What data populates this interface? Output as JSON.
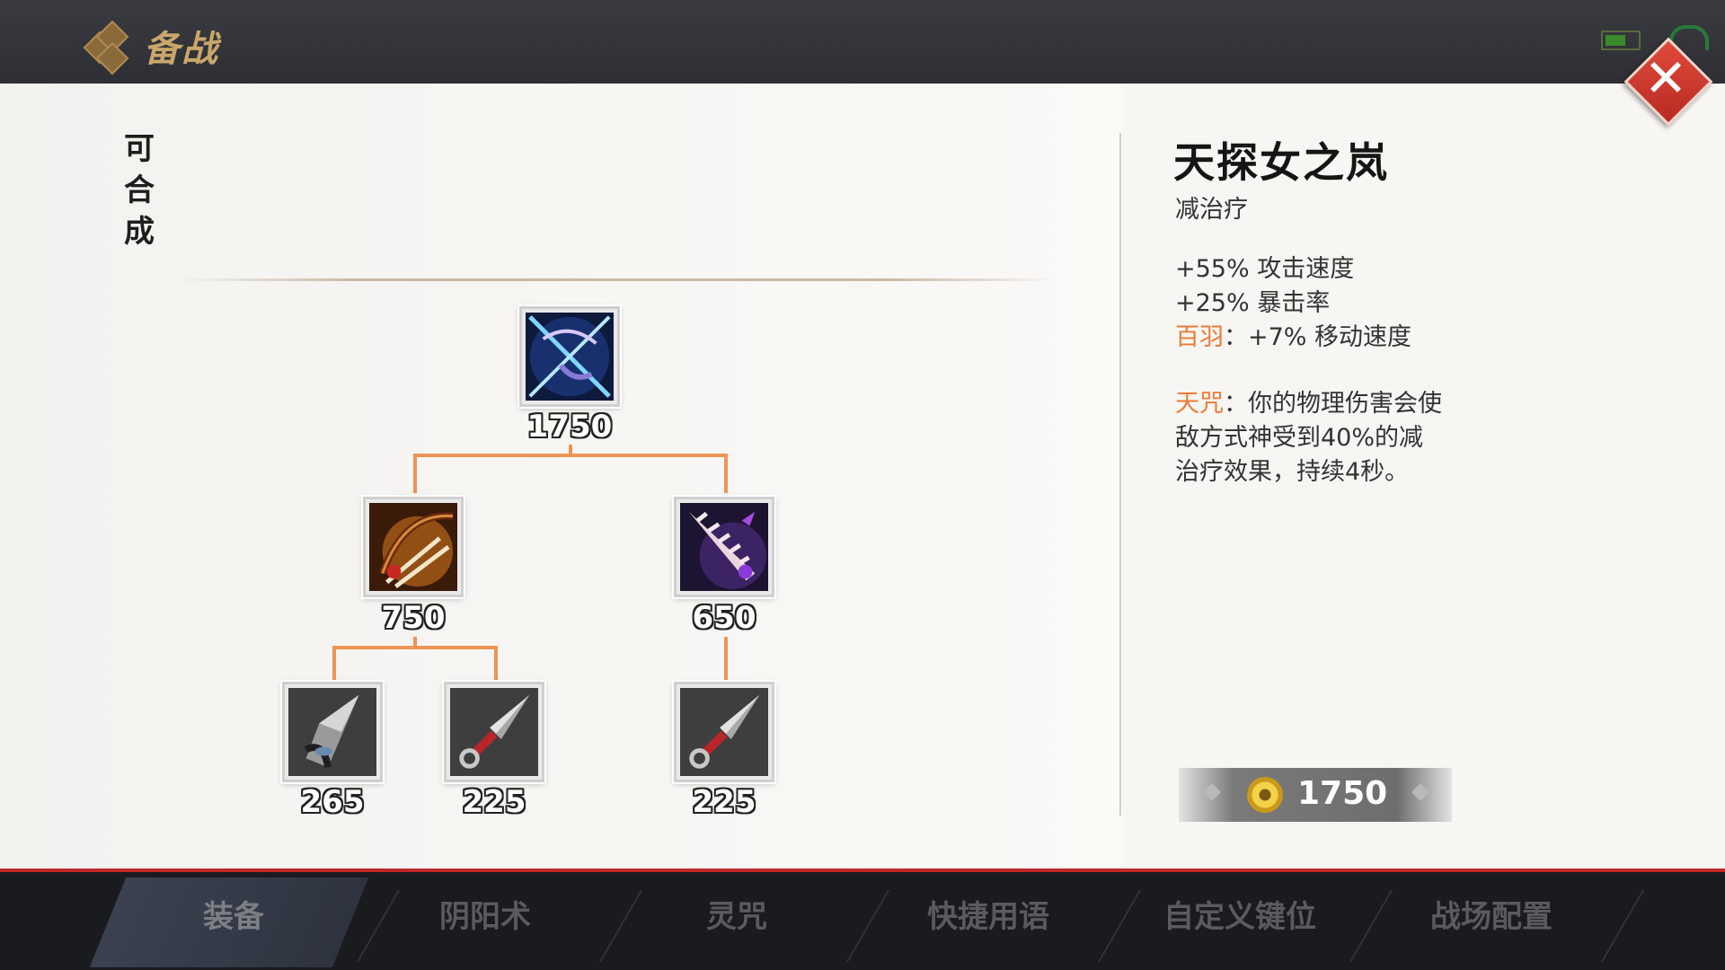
{
  "topbar": {
    "title": "备战"
  },
  "panel": {
    "craftable_label": "可合成"
  },
  "tree": {
    "root": {
      "price": "1750",
      "icon": "crossed-bow-arrow-icon"
    },
    "mid_left": {
      "price": "750",
      "icon": "bow-with-arrows-icon"
    },
    "mid_right": {
      "price": "650",
      "icon": "spiked-claw-blade-icon"
    },
    "leaf_1": {
      "price": "265",
      "icon": "blade-gauntlet-icon"
    },
    "leaf_2": {
      "price": "225",
      "icon": "kunai-dagger-icon"
    },
    "leaf_3": {
      "price": "225",
      "icon": "kunai-dagger-icon"
    }
  },
  "detail": {
    "name": "天探女之岚",
    "tag": "减治疗",
    "stat_1": "+55% 攻击速度",
    "stat_2": "+25% 暴击率",
    "passive_1_name": "百羽",
    "passive_1_text": "：+7% 移动速度",
    "passive_2_name": "天咒",
    "passive_2_text": "：你的物理伤害会使敌方式神受到40%的减治疗效果，持续4秒。",
    "price": "1750"
  },
  "nav": {
    "tab_1": "装备",
    "tab_2": "阴阳术",
    "tab_3": "灵咒",
    "tab_4": "快捷用语",
    "tab_5": "自定义键位",
    "tab_6": "战场配置"
  },
  "colors": {
    "accent": "#ee9455",
    "highlight": "#ee7a36",
    "close": "#d23a2e"
  }
}
